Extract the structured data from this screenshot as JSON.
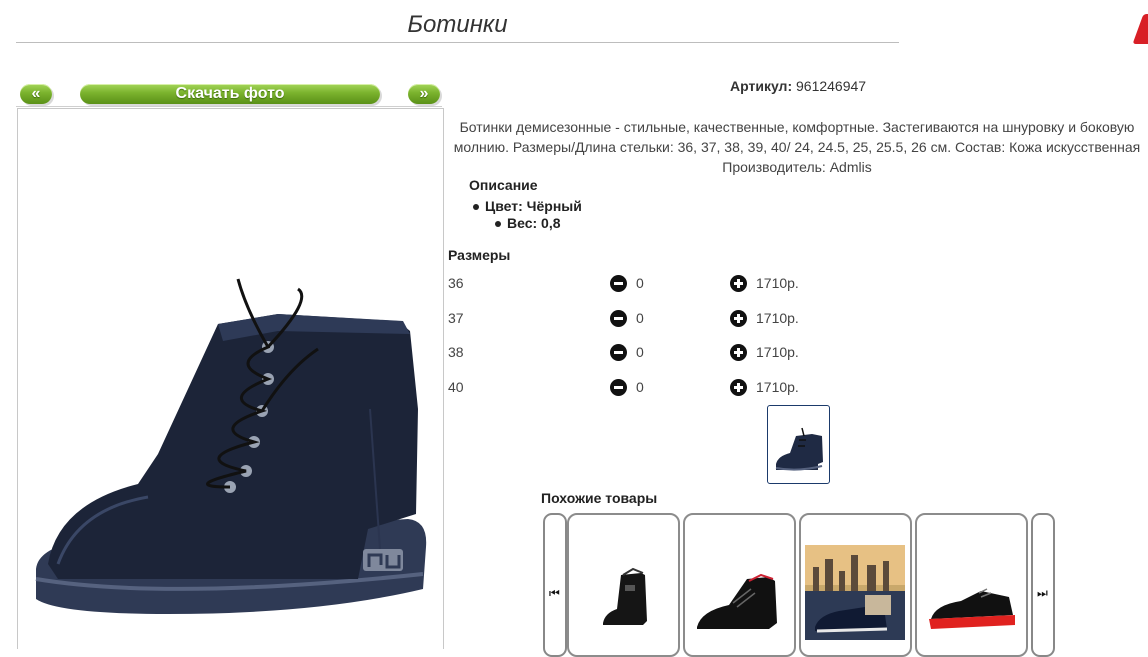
{
  "page": {
    "title": "Ботинки"
  },
  "gallery": {
    "prev_label": "«",
    "download_label": "Скачать фото",
    "next_label": "»"
  },
  "product": {
    "article_label": "Артикул:",
    "article_value": "961246947",
    "description": "Ботинки демисезонные - стильные, качественные, комфортные. Застегиваются на шнуровку и боковую молнию. Размеры/Длина стельки: 36, 37, 38, 39, 40/ 24, 24.5, 25, 25.5, 26 см. Состав: Кожа искусственная",
    "manufacturer": "Производитель: Admlis",
    "description_title": "Описание",
    "props": [
      "Цвет: Чёрный",
      "Вес: 0,8"
    ]
  },
  "sizes": {
    "title": "Размеры",
    "rows": [
      {
        "size": "36",
        "qty": "0",
        "price": "1710р."
      },
      {
        "size": "37",
        "qty": "0",
        "price": "1710р."
      },
      {
        "size": "38",
        "qty": "0",
        "price": "1710р."
      },
      {
        "size": "40",
        "qty": "0",
        "price": "1710р."
      }
    ]
  },
  "similar": {
    "title": "Похожие товары",
    "prev_icon": "skip-back-icon",
    "next_icon": "skip-forward-icon"
  },
  "colors": {
    "button_green": "#7ab22d",
    "boot_navy": "#1f2a44",
    "sole_red": "#e0221f"
  }
}
